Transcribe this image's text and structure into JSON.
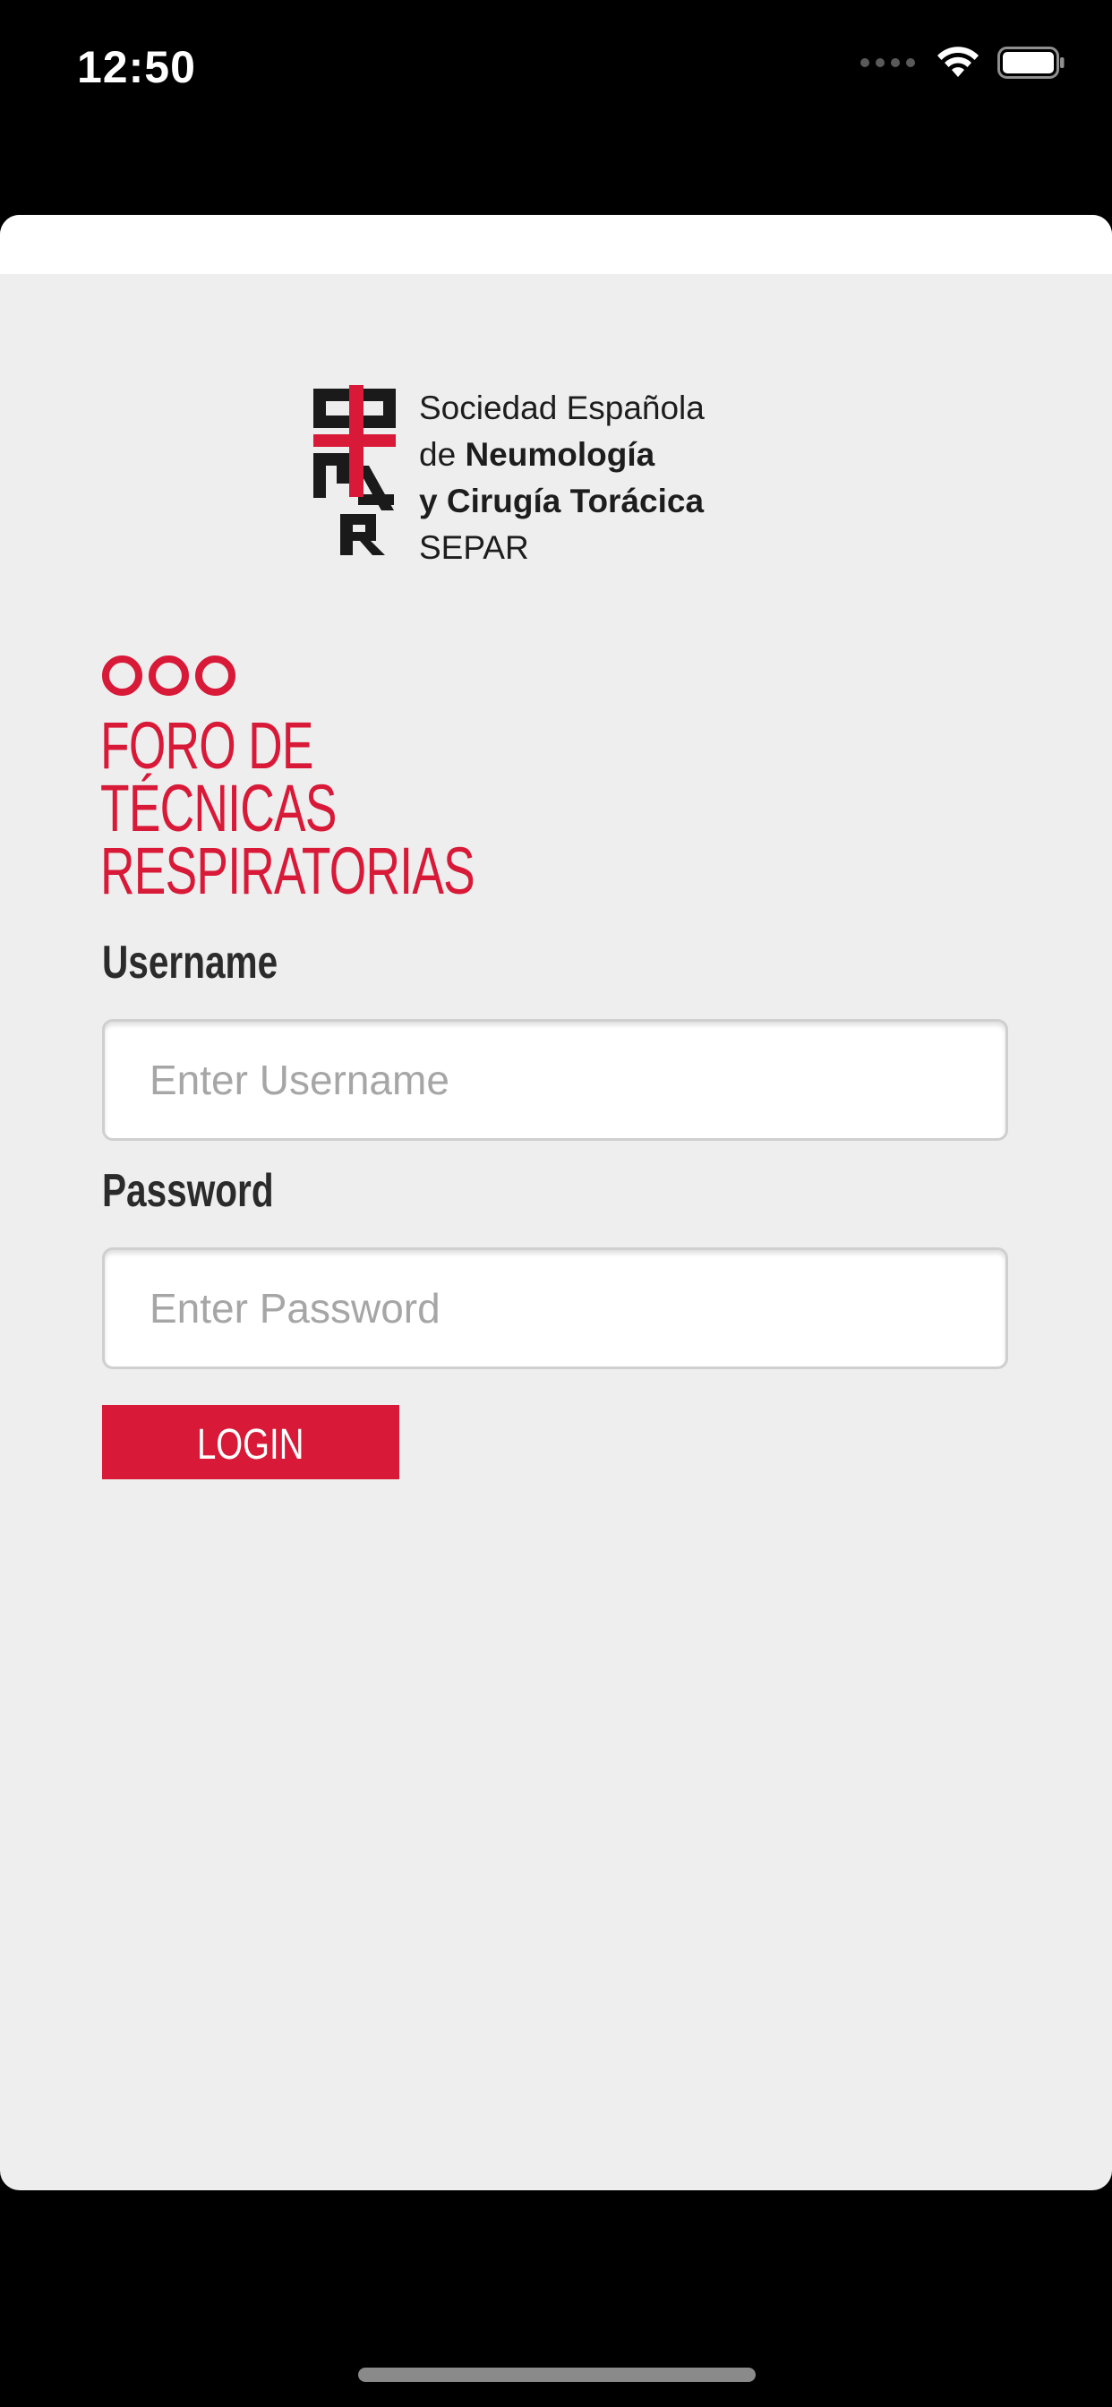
{
  "status_bar": {
    "time": "12:50",
    "icons": [
      "cellular-signal-icon",
      "wifi-icon",
      "battery-icon"
    ]
  },
  "logo": {
    "line1": "Sociedad Española",
    "line2_prefix": "de ",
    "line2_bold": "Neumología",
    "line3": "y Cirugía Torácica",
    "line4": "SEPAR"
  },
  "forum": {
    "title": "FORO DE\nTÉCNICAS\nRESPIRATORIAS"
  },
  "form": {
    "username_label": "Username",
    "username_placeholder": "Enter Username",
    "username_value": "",
    "password_label": "Password",
    "password_placeholder": "Enter Password",
    "password_value": "",
    "login_label": "LOGIN"
  },
  "colors": {
    "brand_red": "#d81937",
    "background": "#eeeeee",
    "text_dark": "#2b2b2b"
  }
}
